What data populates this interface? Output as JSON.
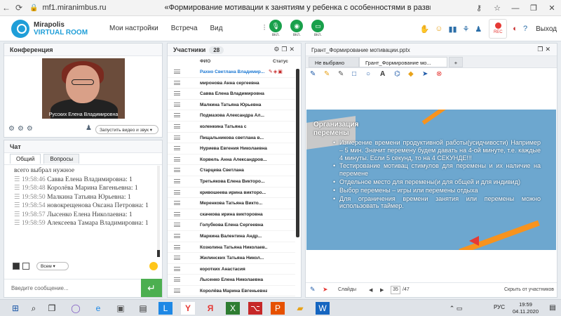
{
  "browser": {
    "url": "mf1.miranimbus.ru",
    "title": "«Формирование мотивации к занятиям у ребенка с особенностями в развитии\""
  },
  "app": {
    "logo_line1": "Mirapolis",
    "logo_line2": "VIRTUAL ROOM",
    "menu": [
      "Мои настройки",
      "Встреча",
      "Вид"
    ],
    "media": [
      {
        "label": "вкл.",
        "icon": "microphone-icon"
      },
      {
        "label": "вкл.",
        "icon": "camera-icon"
      },
      {
        "label": "вкл.",
        "icon": "screen-share-icon"
      }
    ],
    "rec_label": "REC",
    "exit_label": "Выход"
  },
  "conference": {
    "title": "Конференция",
    "video_caption": "Русских Елена Владимировна",
    "share_select": "Запустить видео и звук"
  },
  "chat": {
    "title": "Чат",
    "tabs": [
      "Общий",
      "Вопросы"
    ],
    "messages": [
      {
        "time": "",
        "text": "всего выбрал нужное"
      },
      {
        "time": "19:58:46",
        "text": "Савва Елена Владимировна: 1"
      },
      {
        "time": "19:58:48",
        "text": "Королёва Марина Евгеньевна: 1"
      },
      {
        "time": "19:58:50",
        "text": "Малкина Татьяна  Юрьевна: 1"
      },
      {
        "time": "19:58:54",
        "text": "новокрещенова  Оксана Петровна: 1"
      },
      {
        "time": "19:58:57",
        "text": "Лысенко Елена  Николаевна: 1"
      },
      {
        "time": "19:58:59",
        "text": "Алексеева   Тамара Владимировна: 1"
      }
    ],
    "recipient": "Всем",
    "input_placeholder": "Введите сообщение..."
  },
  "participants": {
    "title": "Участники",
    "count": "28",
    "col_name": "ФИО",
    "col_status": "Статус",
    "list": [
      "Рахно Светлана  Владимир...",
      "миронова  Анна  сергеевна",
      "Савва Елена Владимировна",
      "Малкина Татьяна  Юрьевна",
      "Подмазова Александра  Ал...",
      "коленкина Татьяна  с",
      "Пищальникова  светлана в...",
      "Нуриева Евгения Николаевна",
      "Корвель Анна  Александров...",
      "Старцева Светлана",
      "Третьякова  Елена Викторо...",
      "кривошеева  ирина викторо...",
      "Меренкова  Татьяна Викто...",
      "скачкова ирина викторовна",
      "Голубкова  Елена Сергеевна",
      "Маркина  Валентина  Андр...",
      "Козюлина Татьяна Николаев...",
      "Жилинских  Татьяна  Никол...",
      "коротких Анастасия",
      "Лысенко Елена  Николаевна",
      "Королёва Марина Евгеньевна"
    ]
  },
  "presentation": {
    "title": "Грант_Формирование мотивации.pptx",
    "tabs": [
      "Не выбрано",
      "Грант_Формирование мо...",
      "+"
    ],
    "slide": {
      "heading": "Организация перемены",
      "bullets": [
        "Измерение        времени        продуктивной работы(усидчивости) Например – 5 мин. Значит перемену будем давать на 4-ой минуте, т.е. каждые 4 минуты. Если 5 секунд, то на 4 СЕКУНДЕ!!!",
        "Тестирование мотивац стимулов для перемены и их наличие на перемене",
        "Отдельное место для перемены(и для общей и для индивид)",
        "Выбор перемены – игры или перемены отдыха",
        "Для ограничения времени занятия или перемены можно использовать таймер."
      ]
    },
    "footer": {
      "slides_label": "Слайды",
      "current_page": "35",
      "total_pages": "/47",
      "hide_label": "Скрыть от участников"
    }
  },
  "taskbar": {
    "lang": "РУС",
    "time": "19:59",
    "date": "04.11.2020"
  }
}
